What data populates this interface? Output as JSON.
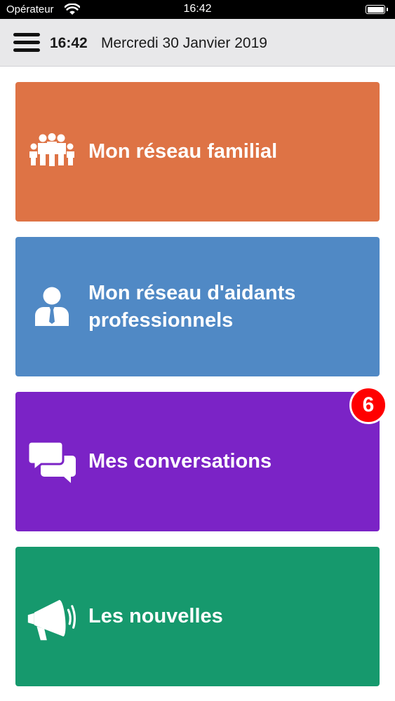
{
  "status_bar": {
    "carrier": "Opérateur",
    "time": "16:42",
    "wifi_icon": "wifi-icon",
    "battery_icon": "battery-icon"
  },
  "header": {
    "menu_icon": "hamburger-menu-icon",
    "time": "16:42",
    "date": "Mercredi 30 Janvier 2019"
  },
  "tiles": [
    {
      "label": "Mon réseau familial",
      "icon": "family-group-icon",
      "color": "#de7345"
    },
    {
      "label": "Mon réseau d'aidants professionnels",
      "icon": "professional-person-icon",
      "color": "#5089c5"
    },
    {
      "label": "Mes conversations",
      "icon": "chat-bubbles-icon",
      "color": "#7b23c6",
      "badge": "6"
    },
    {
      "label": "Les nouvelles",
      "icon": "megaphone-icon",
      "color": "#16996d"
    }
  ],
  "colors": {
    "badge": "#ff0000",
    "header_background": "#e8e8ea"
  }
}
